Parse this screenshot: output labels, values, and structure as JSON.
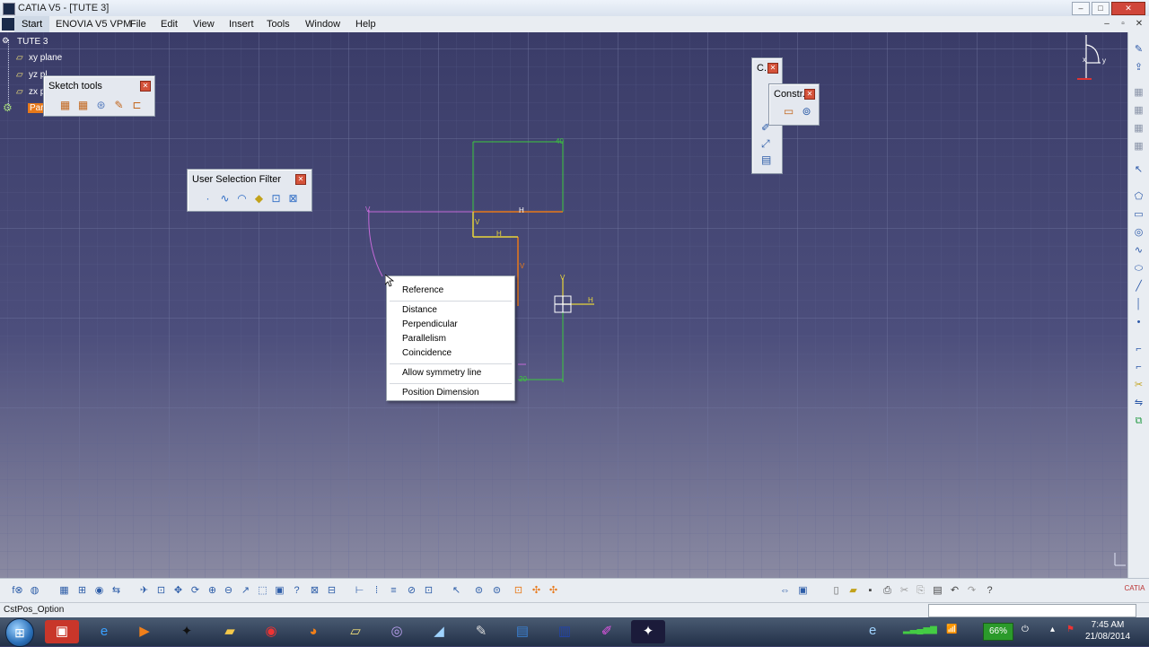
{
  "window": {
    "title": "CATIA V5 - [TUTE 3]",
    "buttons": [
      "–",
      "□",
      "✕"
    ],
    "mdi_buttons": [
      "–",
      "▫",
      "✕"
    ]
  },
  "menubar": {
    "start": "Start",
    "items": [
      "ENOVIA V5 VPM",
      "File",
      "Edit",
      "View",
      "Insert",
      "Tools",
      "Window",
      "Help"
    ]
  },
  "tree": {
    "root": "TUTE 3",
    "items": [
      "xy plane",
      "yz pl",
      "zx p",
      "Par"
    ]
  },
  "palettes": {
    "sketch_tools": {
      "title": "Sketch tools",
      "icons": [
        "grid-icon",
        "snap-to-point-icon",
        "construction-element-icon",
        "geometrical-constraints-icon",
        "dimensional-constraints-icon"
      ]
    },
    "user_selection_filter": {
      "title": "User Selection Filter",
      "icons": [
        "point-filter-icon",
        "curve-filter-icon",
        "surface-filter-icon",
        "volume-filter-icon",
        "feature-filter-icon",
        "geometry-filter-icon"
      ]
    },
    "constraint_small": {
      "title": "C..."
    },
    "constraint": {
      "title": "Constr..."
    }
  },
  "sketch_labels": {
    "h1": "H",
    "h2": "H",
    "v1": "V",
    "v2": "V",
    "h_axis": "H",
    "v_axis": "V",
    "v_small": "V",
    "d40": "40",
    "d20": "20"
  },
  "context_menu": {
    "items": [
      "Reference",
      "Distance",
      "Perpendicular",
      "Parallelism",
      "Coincidence",
      "Allow symmetry line",
      "Position Dimension"
    ]
  },
  "compass": {
    "x": "x",
    "y": "y"
  },
  "status": {
    "text": "CstPos_Option"
  },
  "bottom_right_logo": "CATIA",
  "taskbar": {
    "battery": "66%",
    "time": "7:45 AM",
    "date": "21/08/2014"
  },
  "colors": {
    "viewport": "#4a4b7a",
    "sketch_green": "#3cc93c",
    "sketch_yellow": "#e8d63a",
    "sketch_orange": "#e8791a",
    "sketch_magenta": "#c46ad8"
  }
}
